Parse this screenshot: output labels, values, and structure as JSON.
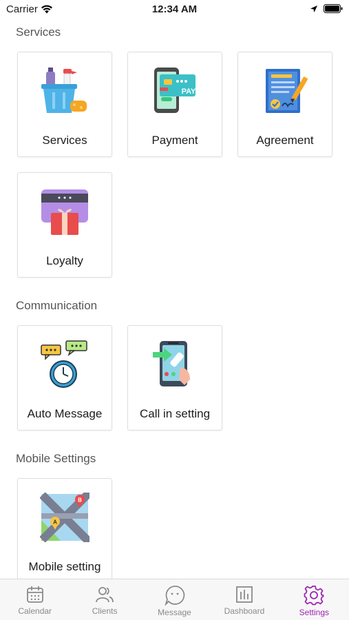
{
  "status_bar": {
    "carrier": "Carrier",
    "time": "12:34 AM"
  },
  "sections": {
    "services": {
      "title": "Services",
      "tiles": [
        "Services",
        "Payment",
        "Agreement",
        "Loyalty"
      ]
    },
    "communication": {
      "title": "Communication",
      "tiles": [
        "Auto Message",
        "Call in setting"
      ]
    },
    "mobile_settings": {
      "title": "Mobile Settings",
      "tiles": [
        "Mobile setting"
      ]
    }
  },
  "icons": {
    "payment_card_text": "PAY"
  },
  "tab_bar": {
    "tabs": [
      {
        "label": "Calendar",
        "icon": "calendar-icon"
      },
      {
        "label": "Clients",
        "icon": "clients-icon"
      },
      {
        "label": "Message",
        "icon": "message-icon"
      },
      {
        "label": "Dashboard",
        "icon": "dashboard-icon"
      },
      {
        "label": "Settings",
        "icon": "settings-icon",
        "active": true
      }
    ]
  },
  "colors": {
    "accent": "#9c27b0",
    "inactive": "#8a8a8a"
  }
}
